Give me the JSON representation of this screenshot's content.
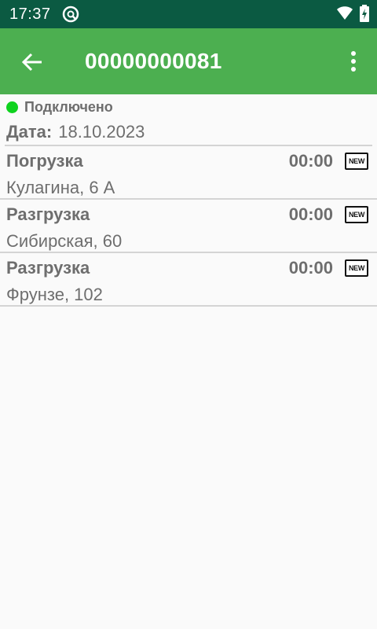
{
  "status_bar": {
    "time": "17:37",
    "icons": [
      "app-icon",
      "wifi-icon",
      "battery-charging-icon"
    ],
    "color": "#0b5a42"
  },
  "app_bar": {
    "title": "00000000081",
    "back_icon": "arrow-left-icon",
    "menu_icon": "more-vert-icon",
    "color": "#4caf50"
  },
  "connection": {
    "label": "Подключено",
    "status_color": "#0fd21f"
  },
  "date": {
    "label": "Дата:",
    "value": "18.10.2023"
  },
  "stops": [
    {
      "type": "Погрузка",
      "time": "00:00",
      "badge": "NEW",
      "address": "Кулагина, 6 А"
    },
    {
      "type": "Разгрузка",
      "time": "00:00",
      "badge": "NEW",
      "address": "Сибирская, 60"
    },
    {
      "type": "Разгрузка",
      "time": "00:00",
      "badge": "NEW",
      "address": "Фрунзе, 102"
    }
  ]
}
